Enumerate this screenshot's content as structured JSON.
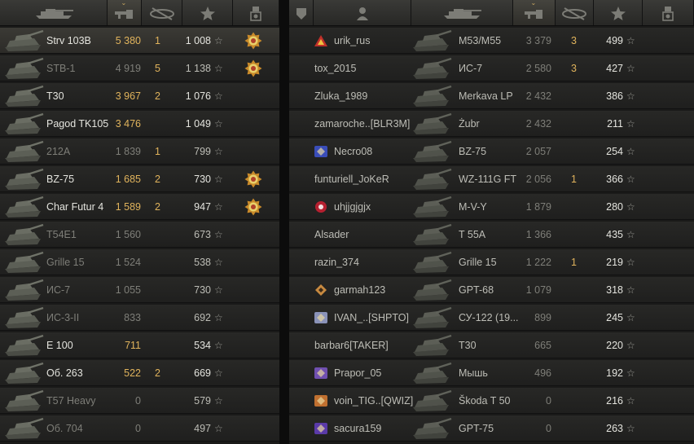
{
  "colors": {
    "gold": "#e0b35c",
    "bright": "#e4e4de",
    "dim": "#7e7e78",
    "normal": "#bdbdb6",
    "star": "#9a9a94"
  },
  "left_header": [
    {
      "name": "tank-column-icon"
    },
    {
      "name": "damage-column-icon",
      "sorted": true
    },
    {
      "name": "kills-column-icon"
    },
    {
      "name": "experience-star-icon"
    },
    {
      "name": "medal-column-icon"
    }
  ],
  "right_header": [
    {
      "name": "clan-column-icon"
    },
    {
      "name": "player-column-icon"
    },
    {
      "name": "tank-column-icon"
    },
    {
      "name": "damage-column-icon",
      "sorted": true
    },
    {
      "name": "kills-column-icon"
    },
    {
      "name": "experience-star-icon"
    },
    {
      "name": "medal-column-icon"
    }
  ],
  "left_rows": [
    {
      "tank": "Strv 103B",
      "damage": "5 380",
      "kills": "1",
      "xp": "1 008",
      "medal": true,
      "highlight": true,
      "bright": true,
      "gold": true
    },
    {
      "tank": "STB-1",
      "damage": "4 919",
      "kills": "5",
      "xp": "1 138",
      "medal": true,
      "bright": false,
      "gold": false
    },
    {
      "tank": "T30",
      "damage": "3 967",
      "kills": "2",
      "xp": "1 076",
      "medal": false,
      "bright": true,
      "gold": true
    },
    {
      "tank": "Pagod TK105",
      "damage": "3 476",
      "kills": "",
      "xp": "1 049",
      "medal": false,
      "bright": true,
      "gold": true
    },
    {
      "tank": "212A",
      "damage": "1 839",
      "kills": "1",
      "xp": "799",
      "medal": false,
      "bright": false,
      "gold": false
    },
    {
      "tank": "BZ-75",
      "damage": "1 685",
      "kills": "2",
      "xp": "730",
      "medal": true,
      "bright": true,
      "gold": true
    },
    {
      "tank": "Char Futur 4",
      "damage": "1 589",
      "kills": "2",
      "xp": "947",
      "medal": true,
      "bright": true,
      "gold": true
    },
    {
      "tank": "T54E1",
      "damage": "1 560",
      "kills": "",
      "xp": "673",
      "medal": false,
      "bright": false,
      "gold": false
    },
    {
      "tank": "Grille 15",
      "damage": "1 524",
      "kills": "",
      "xp": "538",
      "medal": false,
      "bright": false,
      "gold": false
    },
    {
      "tank": "ИС-7",
      "damage": "1 055",
      "kills": "",
      "xp": "730",
      "medal": false,
      "bright": false,
      "gold": false
    },
    {
      "tank": "ИС-3-II",
      "damage": "833",
      "kills": "",
      "xp": "692",
      "medal": false,
      "bright": false,
      "gold": false
    },
    {
      "tank": "E 100",
      "damage": "711",
      "kills": "",
      "xp": "534",
      "medal": false,
      "bright": true,
      "gold": true
    },
    {
      "tank": "Об. 263",
      "damage": "522",
      "kills": "2",
      "xp": "669",
      "medal": false,
      "bright": true,
      "gold": true
    },
    {
      "tank": "T57 Heavy",
      "damage": "0",
      "kills": "",
      "xp": "579",
      "medal": false,
      "bright": false,
      "gold": false
    },
    {
      "tank": "Об. 704",
      "damage": "0",
      "kills": "",
      "xp": "497",
      "medal": false,
      "bright": false,
      "gold": false
    }
  ],
  "right_rows": [
    {
      "clan_icon": "red-triangle-clan-icon",
      "clan_color": "#c0302a",
      "player": "urik_rus",
      "tank": "M53/M55",
      "damage": "3 379",
      "kills": "3",
      "xp": "499"
    },
    {
      "clan_icon": "",
      "player": "tox_2015",
      "tank": "ИС-7",
      "damage": "2 580",
      "kills": "3",
      "xp": "427"
    },
    {
      "clan_icon": "",
      "player": "Zluka_1989",
      "tank": "Merkava LP",
      "damage": "2 432",
      "kills": "",
      "xp": "386"
    },
    {
      "clan_icon": "",
      "player": "zamaroche..[BLR3M]",
      "tank": "Żubr",
      "damage": "2 432",
      "kills": "",
      "xp": "211"
    },
    {
      "clan_icon": "blue-emblem-clan-icon",
      "clan_color": "#3a4db8",
      "player": "Necro08",
      "tank": "BZ-75",
      "damage": "2 057",
      "kills": "",
      "xp": "254"
    },
    {
      "clan_icon": "",
      "player": "funturiell_JoKeR",
      "tank": "WZ-111G FT",
      "damage": "2 056",
      "kills": "1",
      "xp": "366"
    },
    {
      "clan_icon": "red-circle-clan-icon",
      "clan_color": "#b52030",
      "player": "uhjjgjgjx",
      "tank": "M-V-Y",
      "damage": "1 879",
      "kills": "",
      "xp": "280"
    },
    {
      "clan_icon": "",
      "player": "Alsader",
      "tank": "T 55A",
      "damage": "1 366",
      "kills": "",
      "xp": "435"
    },
    {
      "clan_icon": "",
      "player": "razin_374",
      "tank": "Grille 15",
      "damage": "1 222",
      "kills": "1",
      "xp": "219"
    },
    {
      "clan_icon": "diamond-clan-icon",
      "clan_color": "#c88a40",
      "player": "garmah123",
      "tank": "GPT-68",
      "damage": "1 079",
      "kills": "",
      "xp": "318"
    },
    {
      "clan_icon": "wolf-clan-icon",
      "clan_color": "#8a92b8",
      "player": "IVAN_..[SHPTO]",
      "tank": "СУ-122 (19...",
      "damage": "899",
      "kills": "",
      "xp": "245"
    },
    {
      "clan_icon": "",
      "player": "barbar6[TAKER]",
      "tank": "T30",
      "damage": "665",
      "kills": "",
      "xp": "220"
    },
    {
      "clan_icon": "horse-clan-icon",
      "clan_color": "#7050b0",
      "player": "Prapor_05",
      "tank": "Мышь",
      "damage": "496",
      "kills": "",
      "xp": "192"
    },
    {
      "clan_icon": "orange-clan-icon",
      "clan_color": "#c07030",
      "player": "voin_TIG..[QWIZ]",
      "tank": "Škoda T 50",
      "damage": "0",
      "kills": "",
      "xp": "216"
    },
    {
      "clan_icon": "purple-clan-icon",
      "clan_color": "#5a3aa8",
      "player": "sacura159",
      "tank": "GPT-75",
      "damage": "0",
      "kills": "",
      "xp": "263"
    }
  ]
}
